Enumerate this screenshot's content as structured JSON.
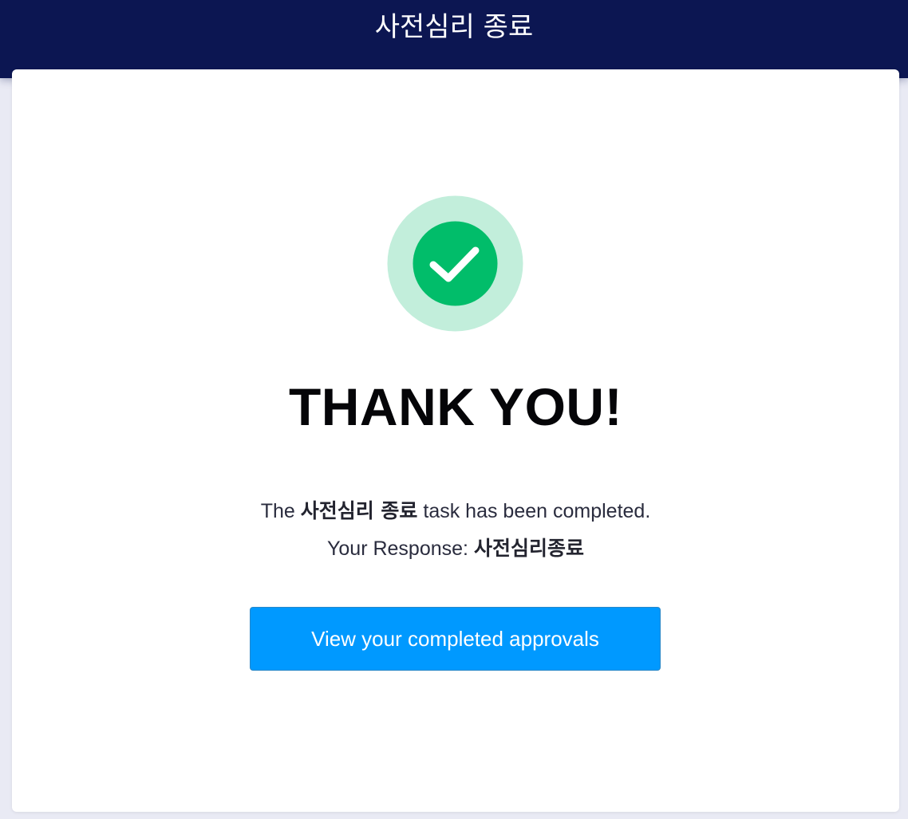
{
  "header": {
    "title": "사전심리 종료"
  },
  "confirmation": {
    "icon": "check-circle-icon",
    "icon_colors": {
      "outer_ring": "#c2eedb",
      "inner_circle": "#01bd6a",
      "check": "#ffffff"
    },
    "title": "THANK YOU!",
    "message_prefix": "The ",
    "task_name": "사전심리 종료",
    "message_suffix": " task has been completed.",
    "response_label": "Your Response: ",
    "response_value": "사전심리종료"
  },
  "actions": {
    "view_completed_label": "View your completed approvals",
    "button_color": "#0099ff"
  },
  "theme": {
    "header_bg": "#0c1652",
    "page_bg": "#e9eaf4",
    "card_bg": "#ffffff"
  }
}
